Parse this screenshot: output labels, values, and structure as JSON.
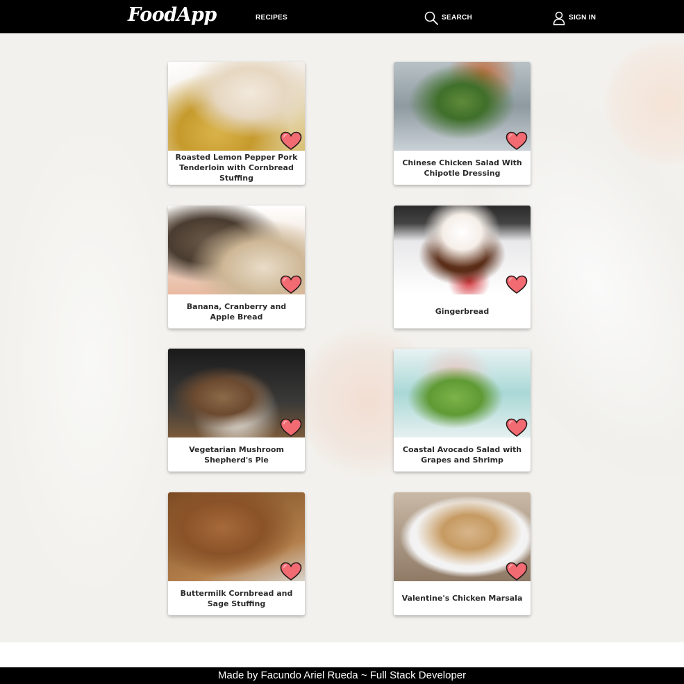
{
  "navbar": {
    "logo": "FoodApp",
    "recipes_label": "RECIPES",
    "search_label": "SEARCH",
    "signin_label": "SIGN IN",
    "search_icon": "search-icon",
    "signin_icon": "user-icon"
  },
  "recipes": [
    {
      "title": "Roasted Lemon Pepper Pork Tenderloin with Cornbread Stuffing"
    },
    {
      "title": "Chinese Chicken Salad With Chipotle Dressing"
    },
    {
      "title": "Banana, Cranberry and Apple Bread"
    },
    {
      "title": "Gingerbread"
    },
    {
      "title": "Vegetarian Mushroom Shepherd's Pie"
    },
    {
      "title": "Coastal Avocado Salad with Grapes and Shrimp"
    },
    {
      "title": "Buttermilk Cornbread and Sage Stuffing"
    },
    {
      "title": "Valentine's Chicken Marsala"
    }
  ],
  "favorite_icon": "heart-icon",
  "colors": {
    "navbar_bg": "#000000",
    "heart_fill": "#f26b73",
    "heart_stroke": "#2a1a1a",
    "page_bg": "#f3f1ed"
  },
  "footer": {
    "text": "Made by Facundo Ariel Rueda ~ Full Stack Developer"
  }
}
